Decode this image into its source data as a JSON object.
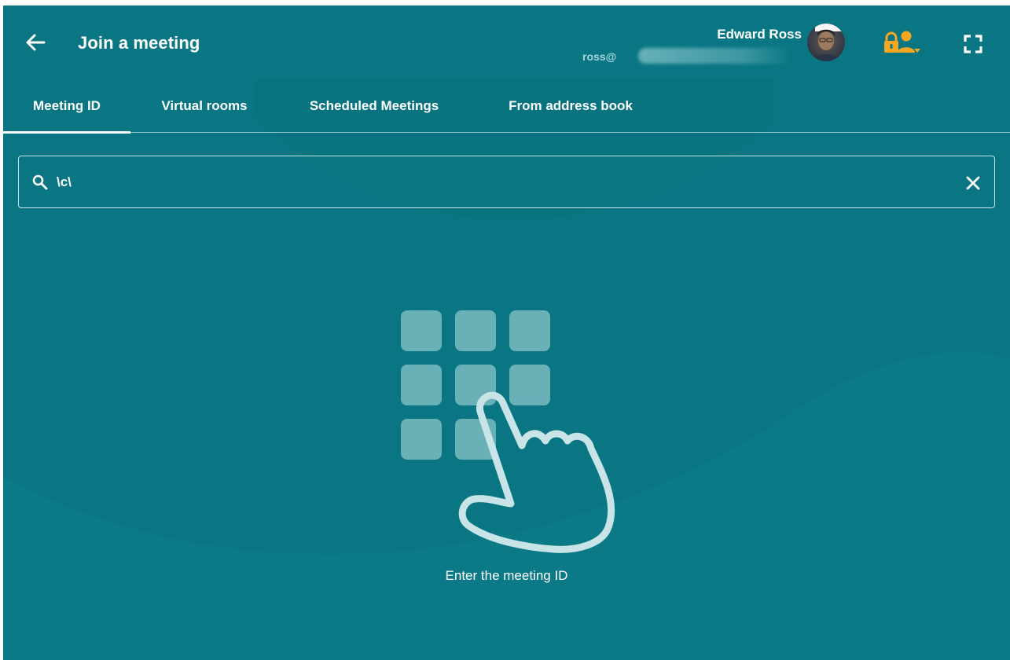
{
  "header": {
    "title": "Join a meeting",
    "user_name": "Edward Ross",
    "user_email": "ross@"
  },
  "tabs": [
    {
      "label": "Meeting ID",
      "active": true
    },
    {
      "label": "Virtual rooms",
      "active": false
    },
    {
      "label": "Scheduled Meetings",
      "active": false
    },
    {
      "label": "From address book",
      "active": false
    }
  ],
  "search": {
    "value": "\\c\\",
    "placeholder": ""
  },
  "main": {
    "hint": "Enter the meeting ID"
  },
  "icons": {
    "back": "arrow-left-icon",
    "lock": "lock-user-icon",
    "fullscreen": "fullscreen-icon",
    "search": "search-icon",
    "clear": "close-icon"
  },
  "colors": {
    "background": "#0b7683",
    "accent": "#f5a623",
    "text": "#ffffff"
  }
}
